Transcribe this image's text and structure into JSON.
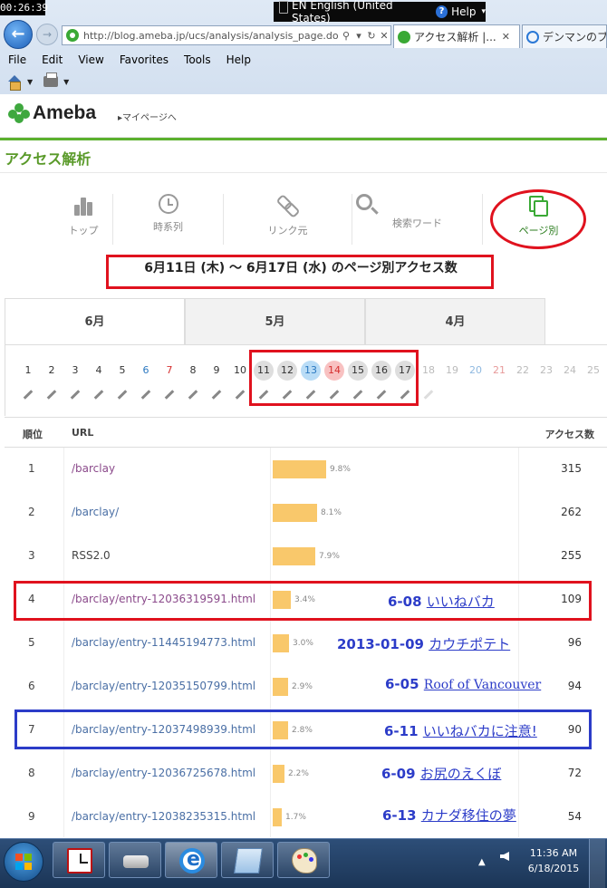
{
  "overlay_time": "00:26:39",
  "langbar": {
    "lang": "EN English (United States)",
    "help": "Help"
  },
  "browser": {
    "url": "http://blog.ameba.jp/ucs/analysis/analysis_page.do",
    "tabs": [
      {
        "title": "アクセス解析 |...",
        "active": true
      },
      {
        "title": "デンマンのブ",
        "active": false
      }
    ],
    "menu": [
      "File",
      "Edit",
      "View",
      "Favorites",
      "Tools",
      "Help"
    ]
  },
  "header": {
    "logo": "Ameba",
    "mypage": "▸マイページへ"
  },
  "page_title": "アクセス解析",
  "nav": [
    {
      "label": "トップ",
      "icon": "bar-chart-icon"
    },
    {
      "label": "時系列",
      "icon": "clock-icon"
    },
    {
      "label": "リンク元",
      "icon": "link-icon"
    },
    {
      "label": "検索ワード",
      "icon": "search-icon"
    },
    {
      "label": "ページ別",
      "icon": "pages-icon",
      "active": true
    }
  ],
  "range_title": "6月11日 (木) ～ 6月17日 (水) のページ別アクセス数",
  "month_tabs": [
    "6月",
    "5月",
    "4月"
  ],
  "days": [
    "1",
    "2",
    "3",
    "4",
    "5",
    "6",
    "7",
    "8",
    "9",
    "10",
    "11",
    "12",
    "13",
    "14",
    "15",
    "16",
    "17",
    "18",
    "19",
    "20",
    "21",
    "22",
    "23",
    "24",
    "25"
  ],
  "table": {
    "headers": {
      "rank": "順位",
      "url": "URL",
      "count": "アクセス数"
    },
    "rows": [
      {
        "rank": "1",
        "url": "/barclay",
        "pct": "9.8%",
        "share": 0.098,
        "count": "315"
      },
      {
        "rank": "2",
        "url": "/barclay/",
        "pct": "8.1%",
        "share": 0.081,
        "count": "262"
      },
      {
        "rank": "3",
        "url": "RSS2.0",
        "pct": "7.9%",
        "share": 0.079,
        "count": "255"
      },
      {
        "rank": "4",
        "url": "/barclay/entry-12036319591.html",
        "pct": "3.4%",
        "share": 0.034,
        "count": "109"
      },
      {
        "rank": "5",
        "url": "/barclay/entry-11445194773.html",
        "pct": "3.0%",
        "share": 0.03,
        "count": "96"
      },
      {
        "rank": "6",
        "url": "/barclay/entry-12035150799.html",
        "pct": "2.9%",
        "share": 0.029,
        "count": "94"
      },
      {
        "rank": "7",
        "url": "/barclay/entry-12037498939.html",
        "pct": "2.8%",
        "share": 0.028,
        "count": "90"
      },
      {
        "rank": "8",
        "url": "/barclay/entry-12036725678.html",
        "pct": "2.2%",
        "share": 0.022,
        "count": "72"
      },
      {
        "rank": "9",
        "url": "/barclay/entry-12038235315.html",
        "pct": "1.7%",
        "share": 0.017,
        "count": "54"
      }
    ]
  },
  "annotations": [
    {
      "date": "6-08",
      "title": "いいねバカ"
    },
    {
      "date": "2013-01-09",
      "title": "カウチポテト"
    },
    {
      "date": "6-05",
      "title": "Roof of Vancouver"
    },
    {
      "date": "6-11",
      "title": "いいねバカに注意!"
    },
    {
      "date": "6-09",
      "title": "お尻のえくぼ"
    },
    {
      "date": "6-13",
      "title": "カナダ移住の夢"
    }
  ],
  "taskbar": {
    "time": "11:36 AM",
    "date": "6/18/2015"
  },
  "colors": {
    "bar": "#f9c86b",
    "brand_green": "#5bb02e",
    "red_mark": "#e0121e",
    "blue_mark": "#2c3cc8"
  }
}
